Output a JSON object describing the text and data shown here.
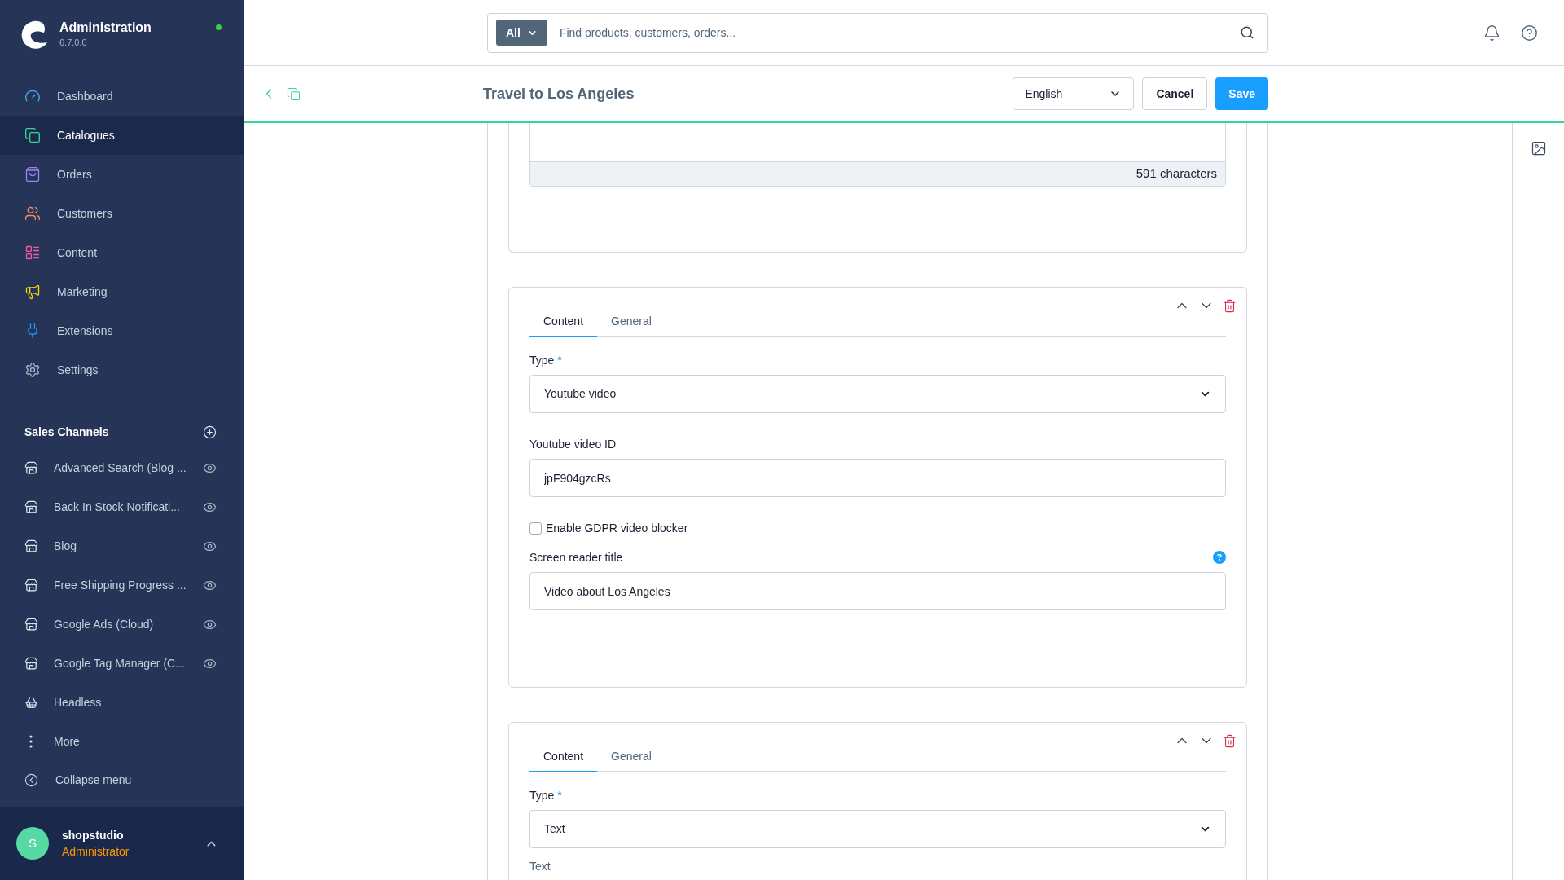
{
  "sidebar": {
    "brand": {
      "title": "Administration",
      "version": "6.7.0.0",
      "online": true
    },
    "nav": [
      {
        "label": "Dashboard",
        "selected": false
      },
      {
        "label": "Catalogues",
        "selected": true
      },
      {
        "label": "Orders",
        "selected": false
      },
      {
        "label": "Customers",
        "selected": false
      },
      {
        "label": "Content",
        "selected": false
      },
      {
        "label": "Marketing",
        "selected": false
      },
      {
        "label": "Extensions",
        "selected": false
      },
      {
        "label": "Settings",
        "selected": false
      }
    ],
    "sales_channels": {
      "title": "Sales Channels",
      "items": [
        {
          "label": "Advanced Search (Blog ...",
          "kind": "storefront"
        },
        {
          "label": "Back In Stock Notificati...",
          "kind": "storefront"
        },
        {
          "label": "Blog",
          "kind": "storefront"
        },
        {
          "label": "Free Shipping Progress ...",
          "kind": "storefront"
        },
        {
          "label": "Google Ads (Cloud)",
          "kind": "storefront"
        },
        {
          "label": "Google Tag Manager (C...",
          "kind": "storefront"
        },
        {
          "label": "Headless",
          "kind": "headless"
        }
      ]
    },
    "more": "More",
    "collapse": "Collapse menu",
    "user": {
      "initial": "S",
      "name": "shopstudio",
      "role": "Administrator"
    }
  },
  "topbar": {
    "search": {
      "scope": "All",
      "placeholder": "Find products, customers, orders..."
    }
  },
  "header": {
    "title": "Travel to Los Angeles",
    "language": "English",
    "buttons": [
      {
        "label": "Cancel",
        "kind": "secondary"
      },
      {
        "label": "Save",
        "kind": "primary"
      }
    ]
  },
  "blocks": [
    {
      "kind": "tail",
      "counter": "591 characters"
    },
    {
      "kind": "element",
      "tabs": [
        {
          "label": "Content",
          "selected": true
        },
        {
          "label": "General",
          "selected": false
        }
      ],
      "fields": [
        {
          "kind": "select",
          "label": "Type",
          "required_mark": "*",
          "value": "Youtube video"
        },
        {
          "kind": "input",
          "label": "Youtube video ID",
          "value": "jpF904gzcRs"
        },
        {
          "kind": "checkbox",
          "label": "Enable GDPR video blocker",
          "checked": false
        },
        {
          "kind": "input",
          "label": "Screen reader title",
          "help": true,
          "value": "Video about Los Angeles"
        }
      ]
    },
    {
      "kind": "element",
      "tabs": [
        {
          "label": "Content",
          "selected": true
        },
        {
          "label": "General",
          "selected": false
        }
      ],
      "fields": [
        {
          "kind": "select",
          "label": "Type",
          "required_mark": "*",
          "value": "Text"
        },
        {
          "kind": "heading",
          "label": "Text"
        }
      ]
    }
  ]
}
